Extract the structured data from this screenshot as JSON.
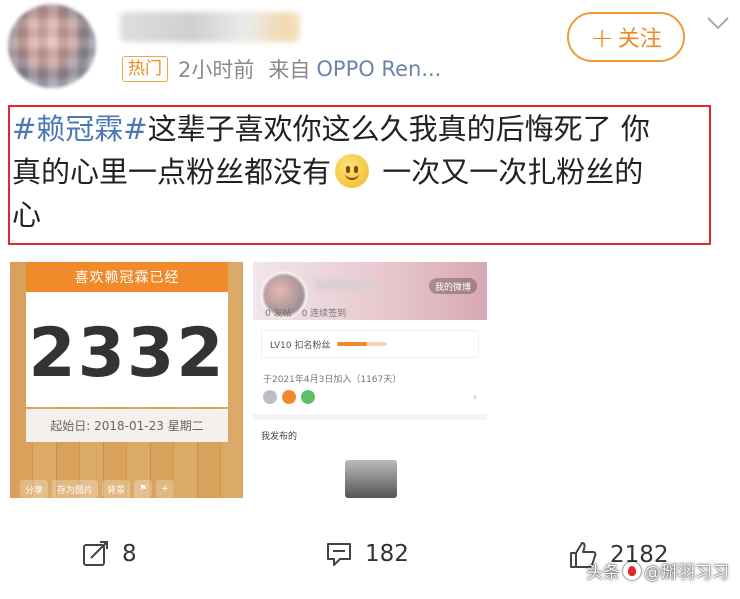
{
  "header": {
    "hot_badge": "热门",
    "time": "2小时前",
    "source_prefix": "来自",
    "source": "OPPO Ren...",
    "follow_label": "关注"
  },
  "post": {
    "hashtag": "#赖冠霖#",
    "text_line1": "这辈子喜欢你这么久我真的后悔死了 你",
    "text_line2_a": "真的心里一点粉丝都没有",
    "text_line2_b": " 一次又一次扎粉丝的",
    "text_line3": "心",
    "emoji": "smile-emoji"
  },
  "image1": {
    "banner": "喜欢赖冠霖已经",
    "count": "2332",
    "start_date": "起始日: 2018-01-23 星期二",
    "toolbar": [
      "分享",
      "存为图片",
      "背景"
    ]
  },
  "image2": {
    "my_weibo": "我的微博",
    "stats": [
      "0 发帖",
      "0 连续签到"
    ],
    "fan_level": "LV10 扣名粉丝",
    "joined": "于2021年4月3日加入（1167天）",
    "published": "我发布的"
  },
  "footer": {
    "reposts": "8",
    "comments": "182",
    "likes": "2182"
  },
  "watermark": {
    "prefix": "头条",
    "name": "@掰羽习习"
  },
  "colors": {
    "accent_orange": "#f08a20",
    "hashtag_blue": "#4c78b5",
    "highlight_red": "#e0282e"
  }
}
